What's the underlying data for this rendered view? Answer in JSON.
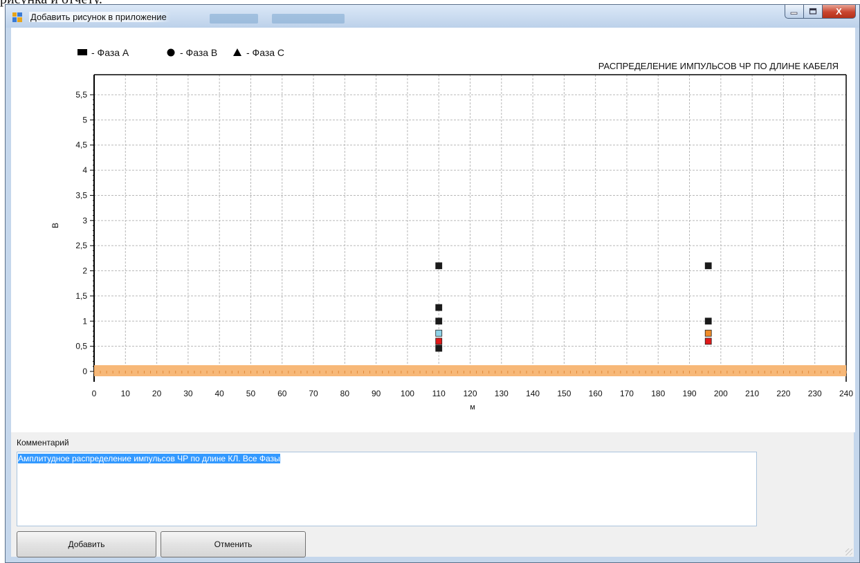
{
  "document_fragment": "рисунка и отчету.",
  "window": {
    "title": "Добавить рисунок в приложение",
    "controls": {
      "minimize_icon": "minimize-icon",
      "maximize_icon": "maximize-icon",
      "close_label": "X"
    }
  },
  "legend": {
    "items": [
      {
        "marker": "square",
        "label": "- Фаза А"
      },
      {
        "marker": "circle",
        "label": "- Фаза В"
      },
      {
        "marker": "triangle",
        "label": "- Фаза С"
      }
    ]
  },
  "chart_data": {
    "type": "scatter",
    "title": "РАСПРЕДЕЛЕНИЕ ИМПУЛЬСОВ ЧР ПО ДЛИНЕ КАБЕЛЯ",
    "xlabel": "м",
    "ylabel": "В",
    "xlim": [
      0,
      240
    ],
    "ylim": [
      0,
      5.5
    ],
    "x_ticks": [
      "0",
      "10",
      "20",
      "30",
      "40",
      "50",
      "60",
      "70",
      "80",
      "90",
      "100",
      "110",
      "120",
      "130",
      "140",
      "150",
      "160",
      "170",
      "180",
      "190",
      "200",
      "210",
      "220",
      "230",
      "240"
    ],
    "y_ticks": [
      "0",
      "0,5",
      "1",
      "1,5",
      "2",
      "2,5",
      "3",
      "3,5",
      "4",
      "4,5",
      "5",
      "5,5"
    ],
    "grid": true,
    "baseline_band_color": "#f7b878",
    "points": [
      {
        "x": 110,
        "y": 2.1,
        "color": "#1a1a1a"
      },
      {
        "x": 110,
        "y": 1.27,
        "color": "#1a1a1a"
      },
      {
        "x": 110,
        "y": 1.0,
        "color": "#1a1a1a"
      },
      {
        "x": 110,
        "y": 0.76,
        "color": "#8fd3e8"
      },
      {
        "x": 110,
        "y": 0.6,
        "color": "#e01818"
      },
      {
        "x": 110,
        "y": 0.46,
        "color": "#1a1a1a"
      },
      {
        "x": 196,
        "y": 2.1,
        "color": "#1a1a1a"
      },
      {
        "x": 196,
        "y": 1.0,
        "color": "#1a1a1a"
      },
      {
        "x": 196,
        "y": 0.76,
        "color": "#f08c28"
      },
      {
        "x": 196,
        "y": 0.6,
        "color": "#e01818"
      }
    ]
  },
  "comment": {
    "label": "Комментарий",
    "value": "Амплитудное распределение импульсов ЧР по длине КЛ. Все Фазы"
  },
  "buttons": {
    "add": "Добавить",
    "cancel": "Отменить"
  }
}
